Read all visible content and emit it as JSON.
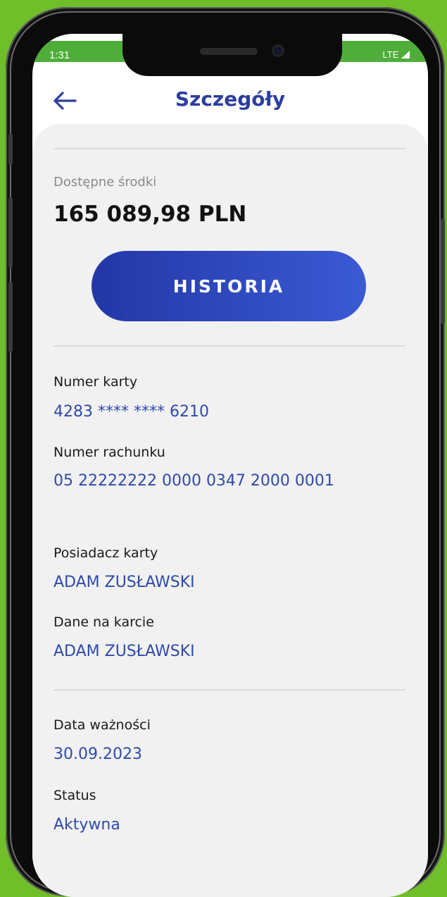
{
  "status_bar": {
    "time": "1:31",
    "network": "LTE"
  },
  "header": {
    "title": "Szczegóły",
    "back_icon": "arrow-left-icon"
  },
  "balance": {
    "label": "Dostępne środki",
    "value": "165 089,98 PLN"
  },
  "history_button": {
    "label": "HISTORIA"
  },
  "fields": [
    {
      "label": "Numer karty",
      "value": "4283 **** **** 6210"
    },
    {
      "label": "Numer rachunku",
      "value": "05 22222222 0000 0347 2000 0001"
    },
    {
      "label": "Posiadacz karty",
      "value": "ADAM ZUSŁAWSKI"
    },
    {
      "label": "Dane na karcie",
      "value": "ADAM ZUSŁAWSKI"
    },
    {
      "label": "Data ważności",
      "value": "30.09.2023"
    },
    {
      "label": "Status",
      "value": "Aktywna"
    }
  ],
  "colors": {
    "background": "#6fbe2a",
    "accent": "#2c3e9e",
    "value_text": "#2f4aa8",
    "button_gradient_start": "#2337a6",
    "button_gradient_end": "#3b5ad4"
  }
}
